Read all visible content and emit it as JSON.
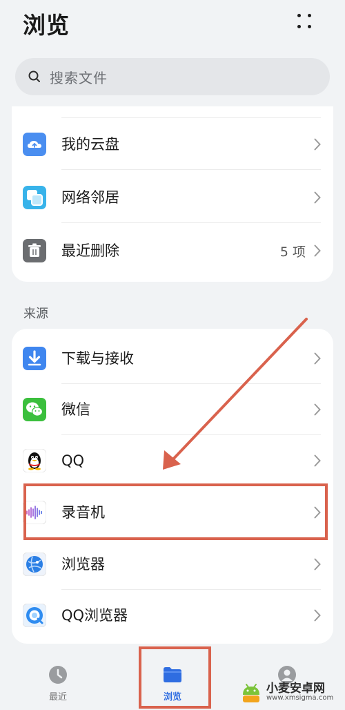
{
  "header": {
    "title": "浏览",
    "more_icon": "more-grid-icon"
  },
  "search": {
    "placeholder": "搜索文件",
    "icon": "search-icon"
  },
  "locations": [
    {
      "label": "我的云盘",
      "icon": "cloud-drive-icon",
      "meta": "",
      "color": "#4a8ef0"
    },
    {
      "label": "网络邻居",
      "icon": "network-neighbor-icon",
      "meta": "",
      "color": "#38b3ea"
    },
    {
      "label": "最近删除",
      "icon": "trash-icon",
      "meta": "5 项",
      "color": "#6b6d70"
    }
  ],
  "sources_title": "来源",
  "sources": [
    {
      "label": "下载与接收",
      "icon": "download-icon",
      "color": "#3f86ef"
    },
    {
      "label": "微信",
      "icon": "wechat-icon",
      "color": "#3bbf3d"
    },
    {
      "label": "QQ",
      "icon": "qq-penguin-icon",
      "color": "#111111"
    },
    {
      "label": "录音机",
      "icon": "voice-recorder-icon",
      "color": "#7b4fd6"
    },
    {
      "label": "浏览器",
      "icon": "browser-globe-icon",
      "color": "#2b7fe5"
    },
    {
      "label": "QQ浏览器",
      "icon": "qq-browser-icon",
      "color": "#2f8cf0"
    }
  ],
  "bottom_nav": [
    {
      "label": "最近",
      "icon": "clock-icon",
      "active": false
    },
    {
      "label": "浏览",
      "icon": "folder-icon",
      "active": true
    },
    {
      "label": "",
      "icon": "user-icon",
      "active": false
    }
  ],
  "watermark": {
    "title": "小麦安卓网",
    "url": "www.xmsigma.com"
  },
  "colors": {
    "accent": "#2f6de1",
    "highlight": "#d9624d",
    "background": "#f1f3f5",
    "card": "#ffffff"
  }
}
